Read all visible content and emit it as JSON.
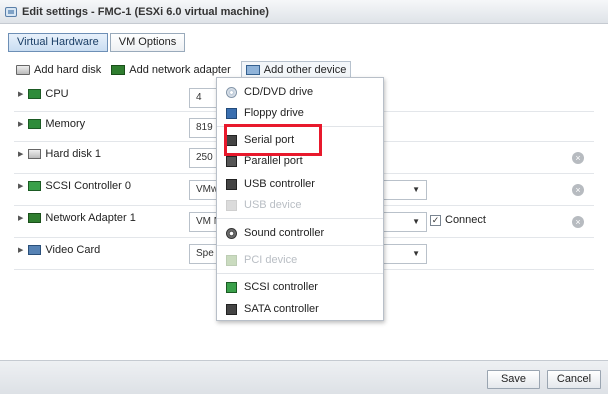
{
  "window": {
    "title": "Edit settings - FMC-1 (ESXi 6.0 virtual machine)"
  },
  "tabs": [
    {
      "label": "Virtual Hardware",
      "active": true
    },
    {
      "label": "VM Options",
      "active": false
    }
  ],
  "toolbar": {
    "add_hard_disk": "Add hard disk",
    "add_network_adapter": "Add network adapter",
    "add_other_device": "Add other device"
  },
  "hardware": {
    "cpu": {
      "label": "CPU",
      "value": "4"
    },
    "memory": {
      "label": "Memory",
      "value": "819"
    },
    "hard_disk": {
      "label": "Hard disk 1",
      "value": "250"
    },
    "scsi": {
      "label": "SCSI Controller 0",
      "value": "VMw"
    },
    "network": {
      "label": "Network Adapter 1",
      "value": "VM N",
      "connect_label": "Connect",
      "connect_checked": true
    },
    "video": {
      "label": "Video Card",
      "value": "Spe"
    }
  },
  "menu": {
    "items": [
      {
        "label": "CD/DVD drive",
        "icon": "cd-dvd-icon",
        "enabled": true
      },
      {
        "label": "Floppy drive",
        "icon": "floppy-icon",
        "enabled": true
      },
      {
        "label": "Serial port",
        "icon": "serial-port-icon",
        "enabled": true
      },
      {
        "label": "Parallel port",
        "icon": "parallel-port-icon",
        "enabled": true
      },
      {
        "label": "USB controller",
        "icon": "usb-controller-icon",
        "enabled": true
      },
      {
        "label": "USB device",
        "icon": "usb-device-icon",
        "enabled": false
      },
      {
        "label": "Sound controller",
        "icon": "sound-icon",
        "enabled": true
      },
      {
        "label": "PCI device",
        "icon": "pci-icon",
        "enabled": false
      },
      {
        "label": "SCSI controller",
        "icon": "scsi-icon",
        "enabled": true
      },
      {
        "label": "SATA controller",
        "icon": "sata-icon",
        "enabled": true
      }
    ],
    "highlighted": "Serial port"
  },
  "footer": {
    "save_label": "Save",
    "cancel_label": "Cancel"
  },
  "colors": {
    "highlight": "#e8192c",
    "accent": "#1a3e66"
  }
}
